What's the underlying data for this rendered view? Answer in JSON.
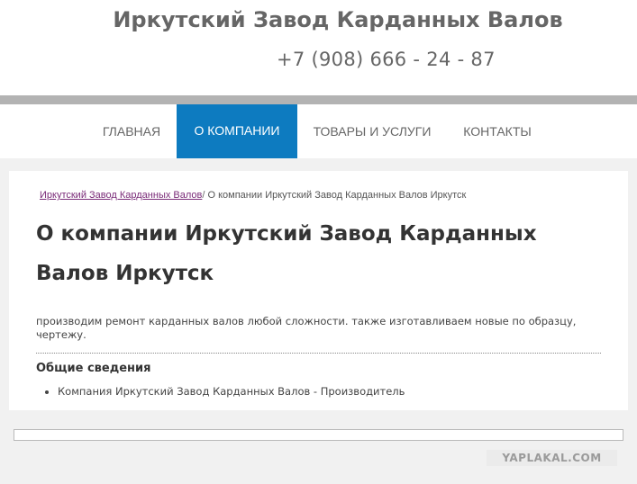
{
  "header": {
    "title": "Иркутский Завод Карданных Валов",
    "phone": "+7 (908) 666 - 24 - 87"
  },
  "nav": {
    "items": [
      {
        "label": "ГЛАВНАЯ"
      },
      {
        "label": "О КОМПАНИИ"
      },
      {
        "label": "ТОВАРЫ И УСЛУГИ"
      },
      {
        "label": "КОНТАКТЫ"
      }
    ],
    "active": "О КОМПАНИИ"
  },
  "breadcrumb": {
    "home": "Иркутский Завод Карданных Валов",
    "separator": "/",
    "current": "О компании Иркутский Завод Карданных Валов Иркутск"
  },
  "page": {
    "title": "О компании Иркутский Завод Карданных Валов Иркутск",
    "description": "производим ремонт карданных валов любой сложности. также изготавливаем новые по образцу, чертежу.",
    "section_heading": "Общие сведения",
    "info_items": [
      "Компания Иркутский Завод Карданных Валов - Производитель"
    ]
  },
  "watermark": "YAPLAKAL.COM",
  "colors": {
    "nav_active": "#0d7bc0",
    "header_divider": "#b3b3b3",
    "page_background": "#f1f1f1",
    "breadcrumb_link": "#7a2b78"
  }
}
